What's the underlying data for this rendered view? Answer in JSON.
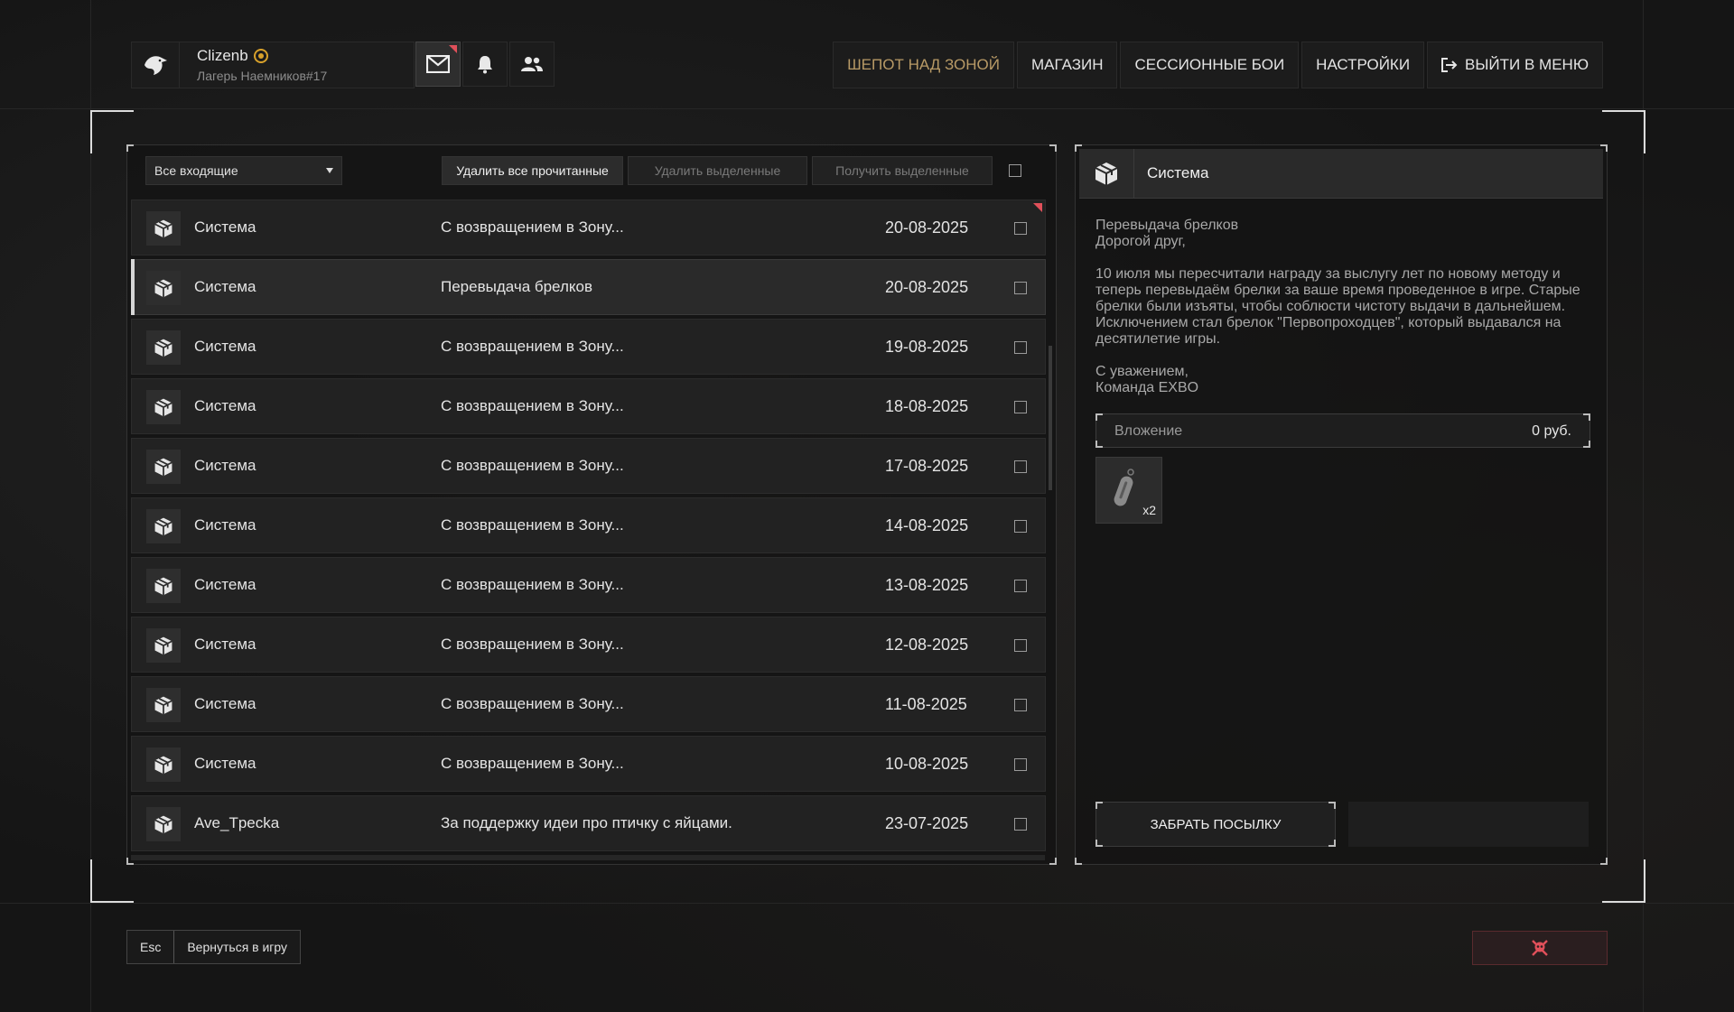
{
  "user": {
    "name": "Clizenb",
    "camp": "Лагерь Наемников#17",
    "badge_color": "#d8a12b"
  },
  "top_icons": [
    "mail-icon",
    "bell-icon",
    "friends-icon"
  ],
  "nav": {
    "items": [
      {
        "label": "ШЕПОТ НАД ЗОНОЙ"
      },
      {
        "label": "МАГАЗИН"
      },
      {
        "label": "СЕССИОННЫЕ БОИ"
      },
      {
        "label": "НАСТРОЙКИ"
      },
      {
        "label": "ВЫЙТИ В МЕНЮ"
      }
    ]
  },
  "toolbar": {
    "filter": "Все входящие",
    "delete_read": "Удалить все прочитанные",
    "delete_selected": "Удалить выделенные",
    "get_selected": "Получить выделенные"
  },
  "mails": [
    {
      "sender": "Система",
      "subject": "С возвращением в Зону...",
      "date": "20-08-2025",
      "unread": true,
      "selected": false
    },
    {
      "sender": "Система",
      "subject": "Перевыдача брелков",
      "date": "20-08-2025",
      "unread": false,
      "selected": true
    },
    {
      "sender": "Система",
      "subject": "С возвращением в Зону...",
      "date": "19-08-2025",
      "unread": false,
      "selected": false
    },
    {
      "sender": "Система",
      "subject": "С возвращением в Зону...",
      "date": "18-08-2025",
      "unread": false,
      "selected": false
    },
    {
      "sender": "Система",
      "subject": "С возвращением в Зону...",
      "date": "17-08-2025",
      "unread": false,
      "selected": false
    },
    {
      "sender": "Система",
      "subject": "С возвращением в Зону...",
      "date": "14-08-2025",
      "unread": false,
      "selected": false
    },
    {
      "sender": "Система",
      "subject": "С возвращением в Зону...",
      "date": "13-08-2025",
      "unread": false,
      "selected": false
    },
    {
      "sender": "Система",
      "subject": "С возвращением в Зону...",
      "date": "12-08-2025",
      "unread": false,
      "selected": false
    },
    {
      "sender": "Система",
      "subject": "С возвращением в Зону...",
      "date": "11-08-2025",
      "unread": false,
      "selected": false
    },
    {
      "sender": "Система",
      "subject": "С возвращением в Зону...",
      "date": "10-08-2025",
      "unread": false,
      "selected": false
    },
    {
      "sender": "Ave_Tpecka",
      "subject": "За поддержку идеи про птичку с яйцами.",
      "date": "23-07-2025",
      "unread": false,
      "selected": false
    }
  ],
  "detail": {
    "sender": "Система",
    "title": "Перевыдача брелков",
    "greeting": "Дорогой друг,",
    "body": "10 июля мы пересчитали награду за выслугу лет по новому методу и теперь перевыдаём брелки за ваше время проведенное в игре. Старые брелки были изъяты, чтобы соблюсти чистоту выдачи в дальнейшем. Исключением стал брелок \"Первопроходцев\", который выдавался на десятилетие игры.",
    "regards": "С уважением,",
    "signature": "Команда EXBO",
    "attachment_label": "Вложение",
    "attachment_price": "0 руб.",
    "attachment_qty": "x2",
    "claim_button": "ЗАБРАТЬ ПОСЫЛКУ"
  },
  "footer": {
    "esc_key": "Esc",
    "back_label": "Вернуться в игру"
  },
  "colors": {
    "unread_flag": "#e0505a",
    "nav_highlight": "#b89a66",
    "danger": "#e0505a"
  }
}
